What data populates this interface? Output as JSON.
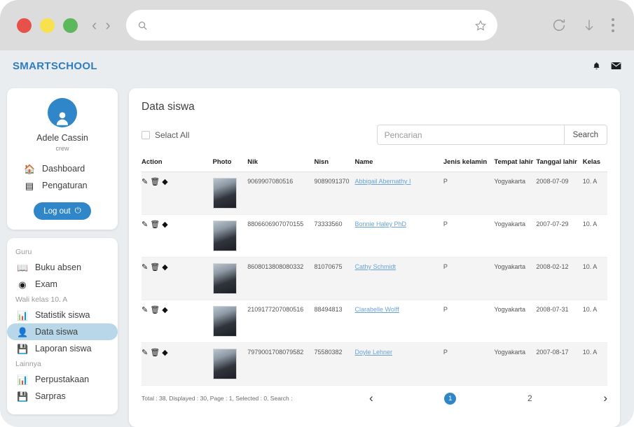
{
  "browser": {
    "dot_colors": [
      "#e8504a",
      "#f7e14f",
      "#5cb85c"
    ],
    "back_icon": "chevron-left-icon",
    "forward_icon": "chevron-right-icon",
    "url_value": "",
    "url_placeholder": "",
    "search_icon": "search-icon",
    "bookmark_icon": "star-icon",
    "reload_icon": "reload-icon",
    "download_icon": "download-arrow-icon",
    "menu_icon": "kebab-menu-icon"
  },
  "appbar": {
    "brand": "SMARTSCHOOL",
    "brand_color": "#2f7cc0",
    "notification_icon": "bell-icon",
    "mail_icon": "envelope-icon"
  },
  "sidebar": {
    "profile": {
      "avatar_icon": "user-avatar-icon",
      "name": "Adele Cassin",
      "role": "crew",
      "items": [
        {
          "label": "Dashboard",
          "icon": "home-icon"
        },
        {
          "label": "Pengaturan",
          "icon": "settings-icon"
        }
      ],
      "logout_label": "Log out",
      "logout_icon": "power-icon"
    },
    "groups": [
      {
        "label": "Guru",
        "items": [
          {
            "label": "Buku absen",
            "icon": "book-icon",
            "active": false
          },
          {
            "label": "Exam",
            "icon": "toggle-icon",
            "active": false
          }
        ]
      },
      {
        "label": "Wali kelas 10. A",
        "items": [
          {
            "label": "Statistik siswa",
            "icon": "bar-chart-icon",
            "active": false
          },
          {
            "label": "Data siswa",
            "icon": "user-gear-icon",
            "active": true
          },
          {
            "label": "Laporan siswa",
            "icon": "save-icon",
            "active": false
          }
        ]
      },
      {
        "label": "Lainnya",
        "items": [
          {
            "label": "Perpustakaan",
            "icon": "bar-chart-icon",
            "active": false
          },
          {
            "label": "Sarpras",
            "icon": "save-icon",
            "active": false
          }
        ]
      }
    ]
  },
  "main": {
    "title": "Data siswa",
    "select_all_label": "Selact All",
    "search": {
      "value": "",
      "placeholder": "Pencarian",
      "button_label": "Search"
    },
    "table": {
      "columns": [
        "Action",
        "Photo",
        "Nik",
        "Nisn",
        "Name",
        "Jenis kelamin",
        "Tempat lahir",
        "Tanggal lahir",
        "Kelas"
      ],
      "action_icons": [
        "pencil-icon",
        "trash-icon",
        "shapes-icon"
      ],
      "rows": [
        {
          "nik": "9069907080516",
          "nisn": "9089091370",
          "name": "Abbigail Abernathy I",
          "jenis_kelamin": "P",
          "tempat_lahir": "Yogyakarta",
          "tanggal_lahir": "2008-07-09",
          "kelas": "10. A"
        },
        {
          "nik": "8806606907070155",
          "nisn": "73333560",
          "name": "Bonnie Haley PhD",
          "jenis_kelamin": "P",
          "tempat_lahir": "Yogyakarta",
          "tanggal_lahir": "2007-07-29",
          "kelas": "10. A"
        },
        {
          "nik": "8608013808080332",
          "nisn": "81070675",
          "name": "Cathy Schmidt",
          "jenis_kelamin": "P",
          "tempat_lahir": "Yogyakarta",
          "tanggal_lahir": "2008-02-12",
          "kelas": "10. A"
        },
        {
          "nik": "2109177207080516",
          "nisn": "88494813",
          "name": "Clarabelle Wolff",
          "jenis_kelamin": "P",
          "tempat_lahir": "Yogyakarta",
          "tanggal_lahir": "2008-07-31",
          "kelas": "10. A"
        },
        {
          "nik": "7979001708079582",
          "nisn": "75580382",
          "name": "Doyle Lehner",
          "jenis_kelamin": "P",
          "tempat_lahir": "Yogyakarta",
          "tanggal_lahir": "2007-08-17",
          "kelas": "10. A"
        }
      ]
    },
    "footer": {
      "summary": "Total : 38, Displayed : 30, Page : 1, Selected : 0, Search :",
      "prev_icon": "chevron-left-icon",
      "next_icon": "chevron-right-icon",
      "pages": [
        "1",
        "2"
      ],
      "current_page": "1",
      "accent_color": "#2f86c8"
    }
  }
}
